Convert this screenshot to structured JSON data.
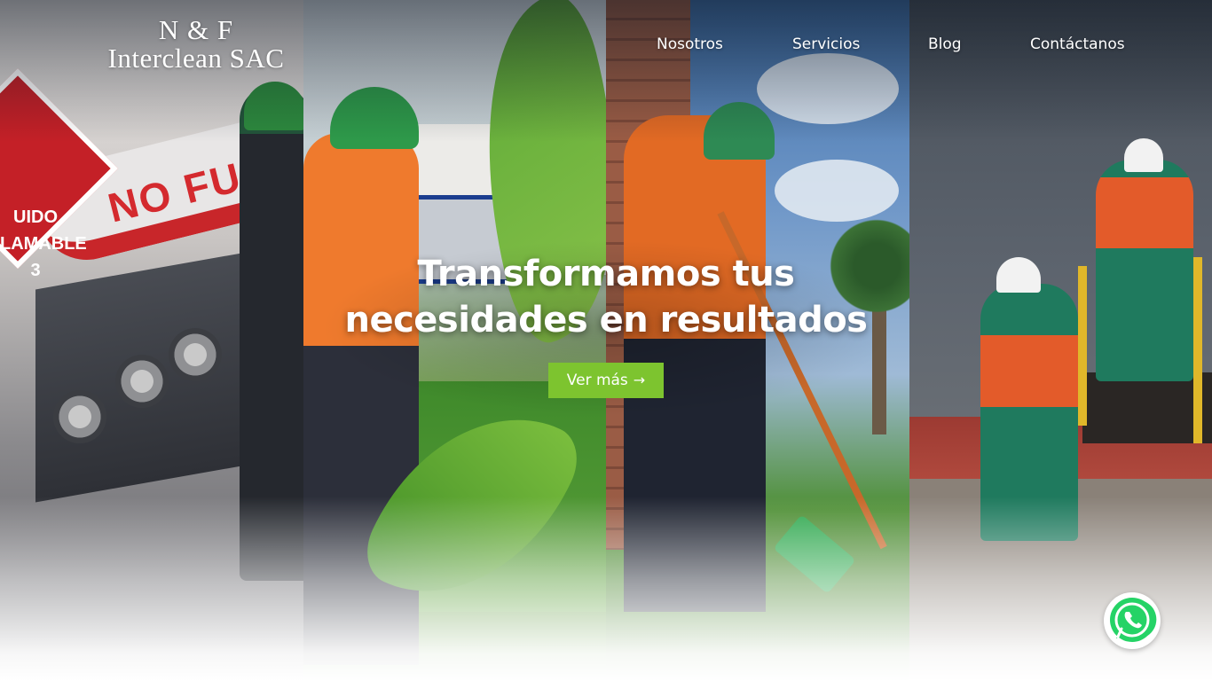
{
  "logo": {
    "line1": "N & F",
    "line2": "Interclean SAC"
  },
  "nav": {
    "items": [
      {
        "label": "Nosotros"
      },
      {
        "label": "Servicios"
      },
      {
        "label": "Blog"
      },
      {
        "label": "Contáctanos"
      }
    ]
  },
  "hero": {
    "title": "Transformamos tus necesidades en resultados",
    "button_label": "Ver más",
    "button_icon": "arrow-right-icon",
    "button_color": "#7dc42f"
  },
  "panel1": {
    "tanker_text": "NO FUM",
    "placard_text": "UIDO LAMABLE 3"
  },
  "whatsapp": {
    "icon": "whatsapp-icon",
    "color": "#25d366"
  }
}
